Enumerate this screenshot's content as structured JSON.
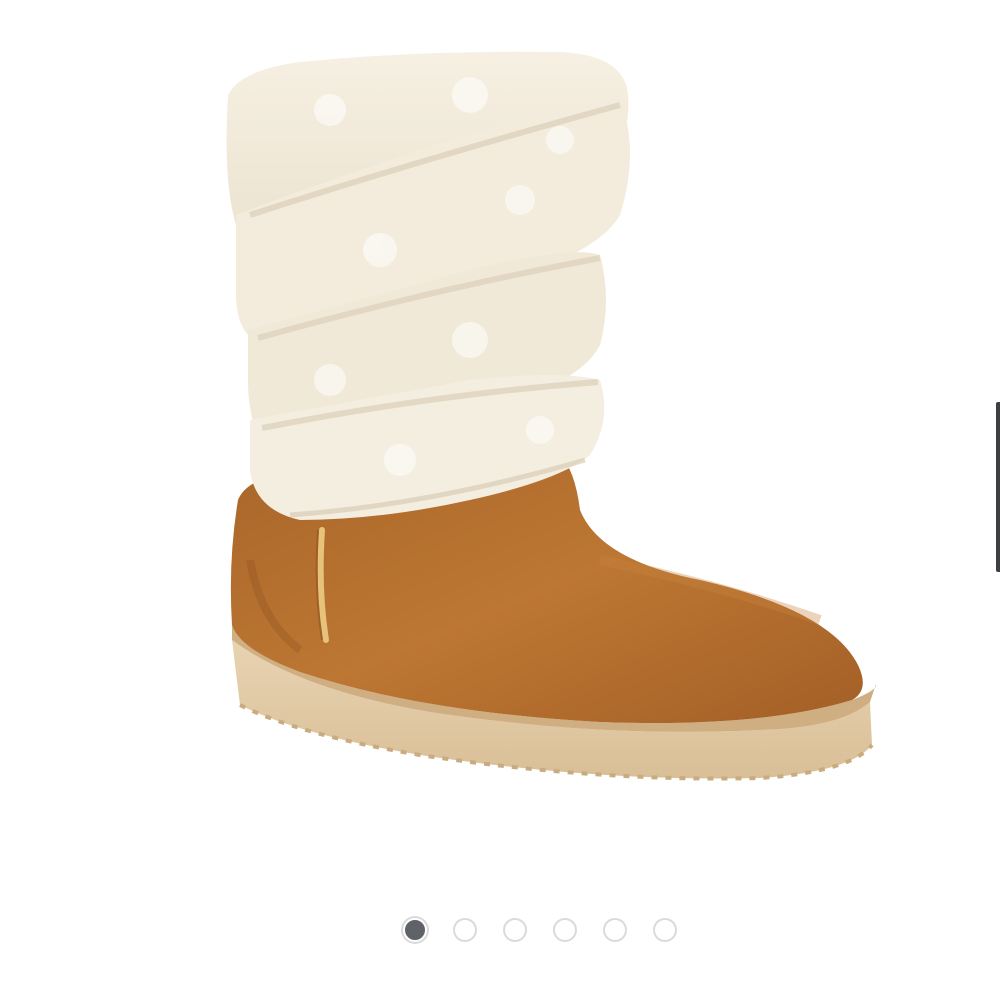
{
  "product_image": {
    "icon": "boot-photo",
    "colors": {
      "suede": "#b9722f",
      "suede_shadow": "#8f5422",
      "fur": "#f2ebdc",
      "fur_shadow": "#ddd2bd",
      "sole": "#e4cdaa",
      "sole_dark": "#c6a57a",
      "stitch": "#e6c27a"
    }
  },
  "carousel": {
    "total": 6,
    "active_index": 0,
    "dot_color_active": "#5f6368",
    "dot_border": "#dadada"
  },
  "edge_indicator": {
    "color": "#3c4043"
  }
}
